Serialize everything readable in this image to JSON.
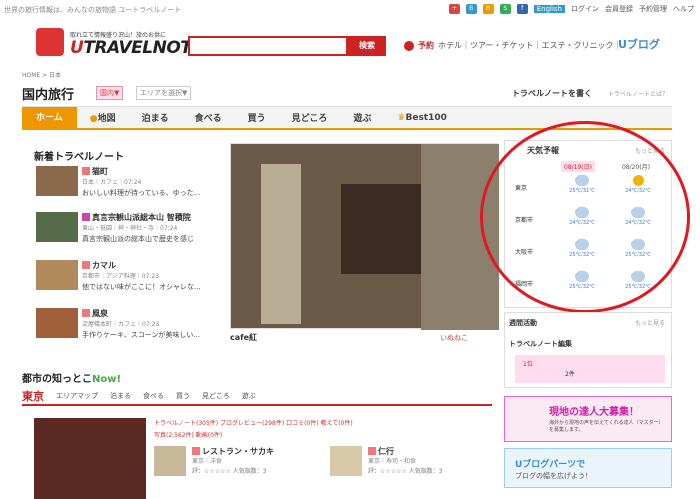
{
  "topbar": {
    "tagline": "世界の旅行情報は、みんなの旅物語 ユートラベルノート",
    "english": "English",
    "login": "ログイン",
    "register": "会員登録",
    "booking": "予約管理",
    "help": "ヘルプ"
  },
  "header": {
    "tag": "取れ立て情報盛り沢山！旅のお供に",
    "logo_u": "U",
    "logo_rest": "TRAVELNOTE",
    "search_button": "検索",
    "yoyaku": "予約",
    "nav": "ホテル｜ツアー・チケット｜エステ・クリニック｜",
    "ublog": "Uブログ"
  },
  "breadcrumb": "HOME > 日本",
  "page": {
    "title": "国内旅行",
    "pill_domestic": "国内▼",
    "pill_area": "エリアを選択▼",
    "write": "トラベルノートを書く",
    "whatis": "トラベルノートとは？"
  },
  "menu": [
    "ホーム",
    "地図",
    "泊まる",
    "食べる",
    "買う",
    "見どころ",
    "遊ぶ",
    "Best100"
  ],
  "new_notes": {
    "title": "新着トラベルノート",
    "items": [
      {
        "name": "猫町",
        "meta": "日本｜カフェ｜07:24",
        "text": "おいしい料理が待っている、ゆった..."
      },
      {
        "name": "真言宗観山派総本山 智積院",
        "meta": "東山・祇園｜神・神社・寺｜07:24",
        "text": "真言宗観山派の総本山で歴史を感じ"
      },
      {
        "name": "カマル",
        "meta": "京都市｜アジア料理｜07:23",
        "text": "他ではない味がここに！オシャレな..."
      },
      {
        "name": "風泉",
        "meta": "淀屋橋本町｜カフェ｜07:23",
        "text": "手作りケーキ、スコーンが美味しい..."
      }
    ]
  },
  "feature": {
    "caption": "cafe紅",
    "author": "いぬねこ"
  },
  "weather": {
    "title": "天気予報",
    "more": "もっと見る",
    "dates": [
      "08/19(日)",
      "08/20(月)"
    ],
    "rows": [
      {
        "city": "東京",
        "d1": "25℃/31℃",
        "d2": "24℃/32℃"
      },
      {
        "city": "京都市",
        "d1": "24℃/32℃",
        "d2": "24℃/32℃"
      },
      {
        "city": "大阪市",
        "d1": "25℃/32℃",
        "d2": "25℃/32℃"
      },
      {
        "city": "福岡市",
        "d1": "25℃/32℃",
        "d2": "25℃/32℃"
      }
    ]
  },
  "ranking": {
    "title": "週間活動",
    "more": "もっと見る",
    "sub": "トラベルノート編集",
    "rank": "1位",
    "count": "2件"
  },
  "city": {
    "title": "都市の知っとこ",
    "now": "Now!",
    "name": "東京",
    "tabs": [
      "エリアマップ",
      "泊まる",
      "食べる",
      "買う",
      "見どころ",
      "遊ぶ"
    ],
    "links": "トラベルノート(305件) ブログレビュー(298件) 口コミ(0件) 教えて(0件)",
    "links2": "写真(2,562件) 動画(0件)",
    "spots": [
      {
        "name": "レストラン・サカキ",
        "meta": "東京｜洋食",
        "rating": "評：☆☆☆☆☆ 人気指数：3"
      },
      {
        "name": "仁行",
        "meta": "東京｜寿司・和食",
        "rating": "評：☆☆☆☆☆ 人気指数：3"
      }
    ]
  },
  "banners": {
    "b1_title": "現地の達人大募集！",
    "b1_text": "海外から現地の声を伝えてくれる達人（マスター）を募集します。",
    "b2_title": "Uブログパーツで",
    "b2_text": "ブログの幅を広げよう！"
  }
}
